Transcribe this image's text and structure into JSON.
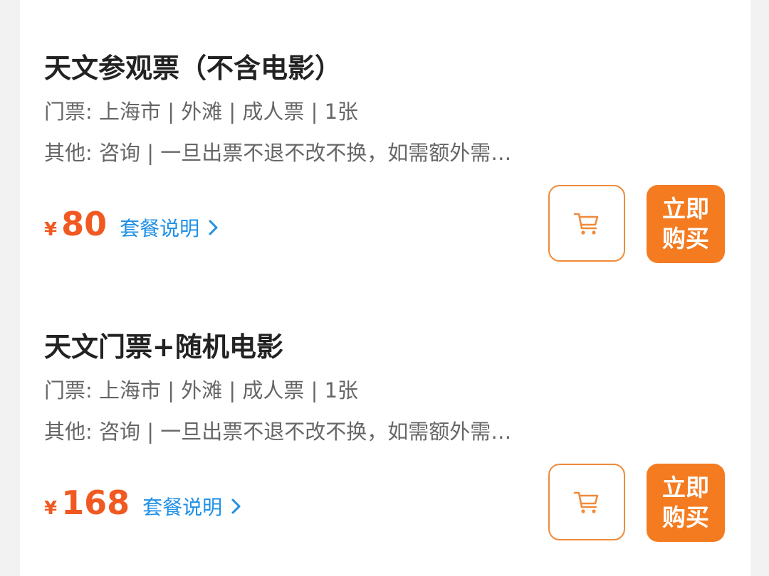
{
  "products": [
    {
      "title": "天文参观票（不含电影）",
      "ticket_line": "门票: 上海市 | 外滩 | 成人票 | 1张",
      "other_line": "其他: 咨询 | 一旦出票不退不改不换，如需额外需…",
      "currency": "¥",
      "price": "80",
      "package_link": "套餐说明",
      "buy_label": "立即购买",
      "cart_icon": "cart-icon"
    },
    {
      "title": "天文门票+随机电影",
      "ticket_line": "门票: 上海市 | 外滩 | 成人票 | 1张",
      "other_line": "其他: 咨询 | 一旦出票不退不改不换，如需额外需…",
      "currency": "¥",
      "price": "168",
      "package_link": "套餐说明",
      "buy_label": "立即购买",
      "cart_icon": "cart-icon"
    }
  ],
  "colors": {
    "price": "#f05a22",
    "link": "#1e90e6",
    "buy_button": "#f47b20",
    "cart_border": "#f08a3a",
    "title": "#222222",
    "secondary_text": "#666666"
  }
}
